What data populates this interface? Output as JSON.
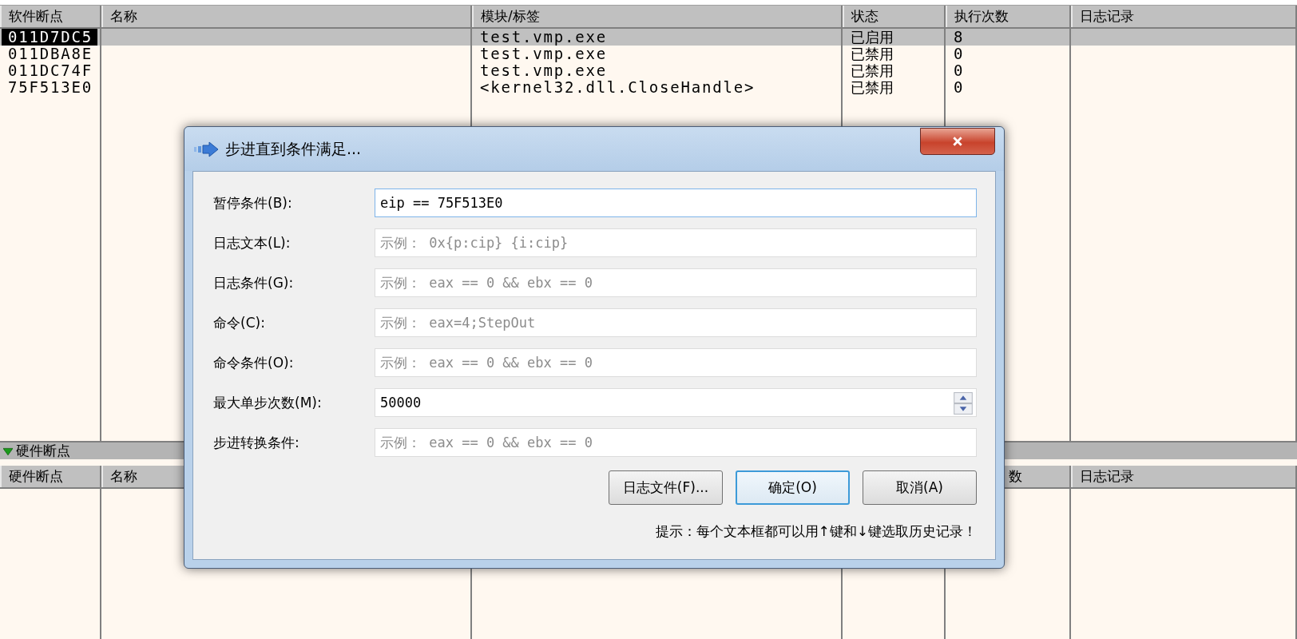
{
  "breakpoints_table": {
    "columns": [
      "软件断点",
      "名称",
      "模块/标签",
      "状态",
      "执行次数",
      "日志记录"
    ],
    "rows": [
      {
        "address": "011D7DC5",
        "module": "test.vmp.exe",
        "status": "已启用",
        "count": "8",
        "selected": true
      },
      {
        "address": "011DBA8E",
        "module": "test.vmp.exe",
        "status": "已禁用",
        "count": "0",
        "selected": false
      },
      {
        "address": "011DC74F",
        "module": "test.vmp.exe",
        "status": "已禁用",
        "count": "0",
        "selected": false
      },
      {
        "address": "75F513E0",
        "module": "<kernel32.dll.CloseHandle>",
        "status": "已禁用",
        "count": "0",
        "selected": false
      }
    ]
  },
  "hardware_section": {
    "title": "硬件断点",
    "expanded": true,
    "columns": [
      {
        "label": "硬件断点",
        "kind": "full"
      },
      {
        "label": "名称",
        "kind": "full"
      },
      {
        "label": "数",
        "kind": "partial"
      },
      {
        "label": "日志记录",
        "kind": "full"
      }
    ]
  },
  "dialog": {
    "title": "步进直到条件满足...",
    "fields": [
      {
        "label": "暂停条件(B):",
        "value": "eip == 75F513E0",
        "kind": "text",
        "focused": true
      },
      {
        "label": "日志文本(L):",
        "placeholder": "示例： 0x{p:cip} {i:cip}",
        "kind": "text",
        "focused": false
      },
      {
        "label": "日志条件(G):",
        "placeholder": "示例： eax == 0 && ebx == 0",
        "kind": "text",
        "focused": false
      },
      {
        "label": "命令(C):",
        "placeholder": "示例： eax=4;StepOut",
        "kind": "text",
        "focused": false
      },
      {
        "label": "命令条件(O):",
        "placeholder": "示例： eax == 0 && ebx == 0",
        "kind": "text",
        "focused": false
      },
      {
        "label": "最大单步次数(M):",
        "value": "50000",
        "kind": "spin",
        "focused": false
      },
      {
        "label": "步进转换条件:",
        "placeholder": "示例： eax == 0 && ebx == 0",
        "kind": "text",
        "focused": false
      }
    ],
    "buttons": [
      {
        "label": "日志文件(F)...",
        "default": false
      },
      {
        "label": "确定(O)",
        "default": true
      },
      {
        "label": "取消(A)",
        "default": false
      }
    ],
    "hint": "提示：每个文本框都可以用↑键和↓键选取历史记录！"
  }
}
